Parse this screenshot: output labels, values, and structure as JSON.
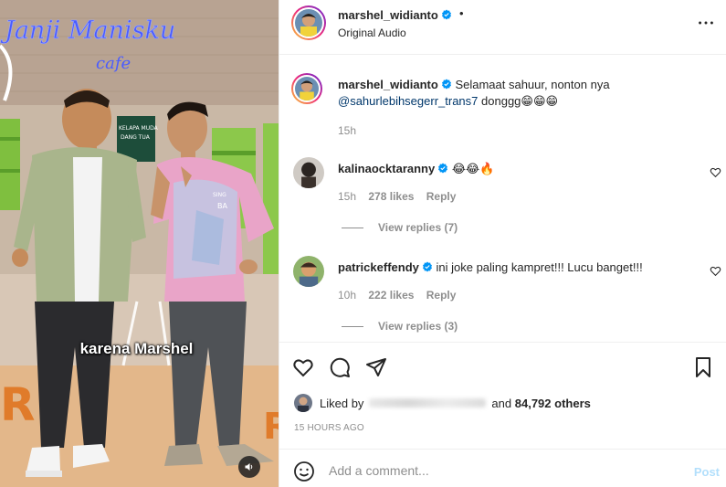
{
  "media": {
    "caption": "karena Marshel",
    "sign_text": "Janji Manisku",
    "sign_sub": "cafe",
    "board_text": "KELAPA MUDA\nDANG TUA",
    "shirt_text": "SING\nBA"
  },
  "header": {
    "username": "marshel_widianto",
    "dot": "•",
    "audio": "Original Audio"
  },
  "caption_post": {
    "username": "marshel_widianto",
    "text_before": "Selamaat sahuur, nonton nya",
    "mention": "@sahurlebihsegerr_trans7",
    "text_after": "donggg😁😁😁",
    "time": "15h"
  },
  "comments": [
    {
      "username": "kalinaocktaranny",
      "text": "😂😂🔥",
      "time": "15h",
      "likes": "278 likes",
      "reply": "Reply",
      "view_replies": "View replies (7)"
    },
    {
      "username": "patrickeffendy",
      "text": "ini joke paling kampret!!! Lucu banget!!!",
      "time": "10h",
      "likes": "222 likes",
      "reply": "Reply",
      "view_replies": "View replies (3)"
    }
  ],
  "likes": {
    "liked_by": "Liked by",
    "and_others": "and",
    "count": "84,792 others"
  },
  "timeago": "15 HOURS AGO",
  "add_comment": {
    "placeholder": "Add a comment...",
    "post": "Post"
  },
  "colors": {
    "verified": "#0095f6",
    "post_disabled": "#b2dffc",
    "secondary_text": "#8e8e8e"
  },
  "icons": [
    "verified-icon",
    "more-icon",
    "heart-icon",
    "comment-icon",
    "share-icon",
    "bookmark-icon",
    "emoji-icon",
    "speaker-icon"
  ]
}
